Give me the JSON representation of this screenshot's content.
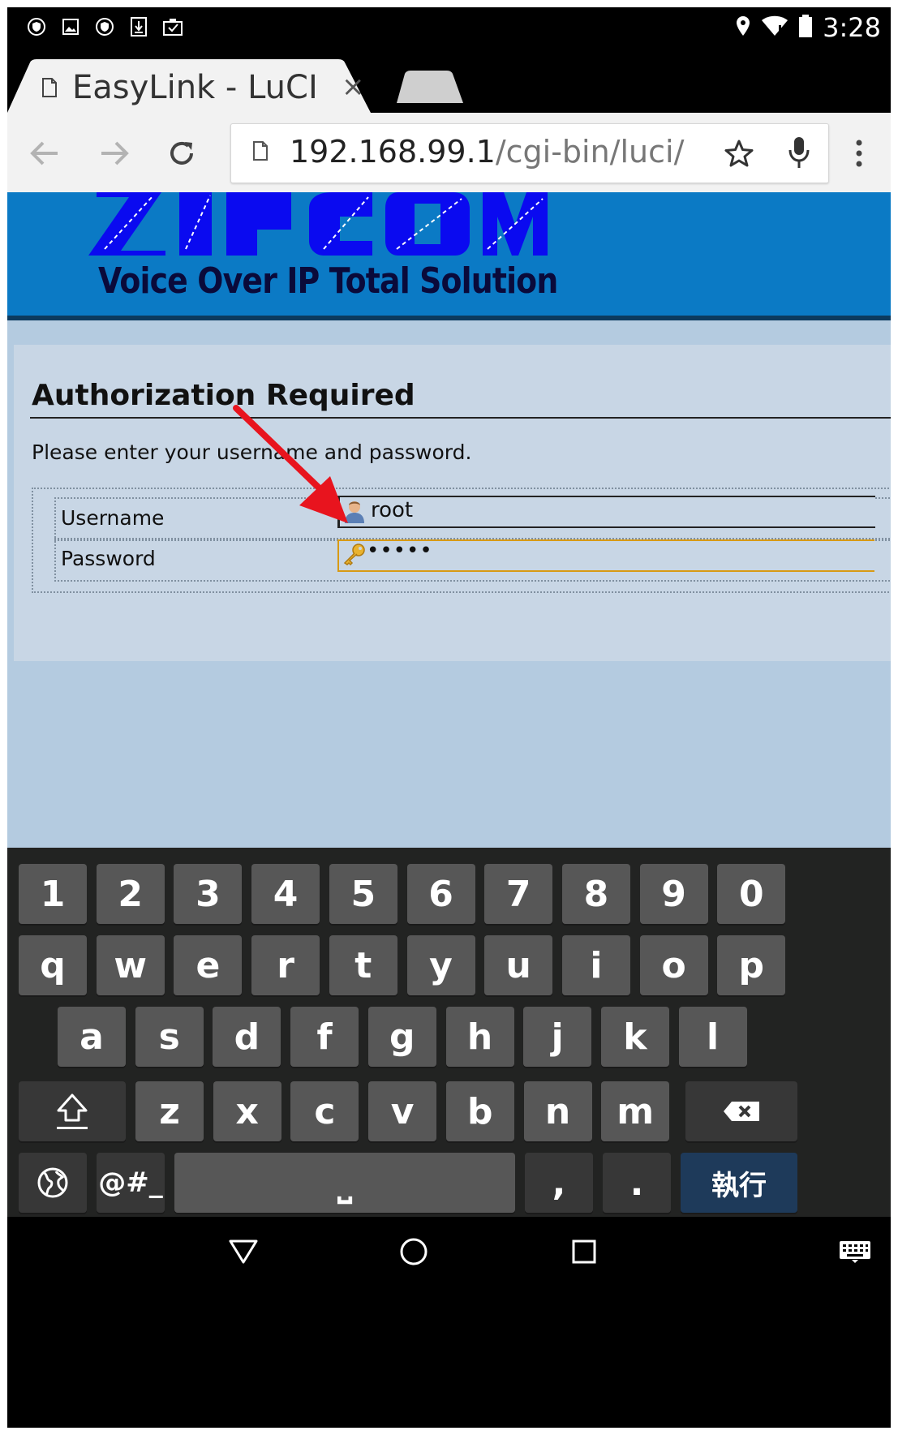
{
  "status_bar": {
    "time": "3:28",
    "left_icons": [
      "shield-icon",
      "image-icon",
      "shield-icon",
      "download-icon",
      "clipboard-icon"
    ],
    "right_icons": [
      "location-icon",
      "wifi-icon",
      "battery-icon"
    ]
  },
  "browser": {
    "tab": {
      "title": "EasyLink - LuCI",
      "close_label": "×"
    },
    "url_host": "192.168.99.1",
    "url_path": "/cgi-bin/luci/"
  },
  "page": {
    "banner_tagline": "Voice Over IP Total Solution",
    "title": "Authorization Required",
    "instruction": "Please enter your username and password.",
    "fields": [
      {
        "label": "Username",
        "value": "root",
        "icon": "user-icon"
      },
      {
        "label": "Password",
        "value": "•••••",
        "icon": "key-icon"
      }
    ],
    "colors": {
      "banner": "#0b7ac5",
      "page_bg": "#b4cbe0",
      "focus_border": "#d89a14",
      "arrow": "#e8141e"
    }
  },
  "keyboard": {
    "row1": [
      "1",
      "2",
      "3",
      "4",
      "5",
      "6",
      "7",
      "8",
      "9",
      "0"
    ],
    "row2": [
      "q",
      "w",
      "e",
      "r",
      "t",
      "y",
      "u",
      "i",
      "o",
      "p"
    ],
    "row3": [
      "a",
      "s",
      "d",
      "f",
      "g",
      "h",
      "j",
      "k",
      "l"
    ],
    "row4": [
      "z",
      "x",
      "c",
      "v",
      "b",
      "n",
      "m"
    ],
    "symbols_label": "@#_",
    "space_label": "⎵",
    "comma_label": ",",
    "period_label": ".",
    "action_label": "執行"
  }
}
